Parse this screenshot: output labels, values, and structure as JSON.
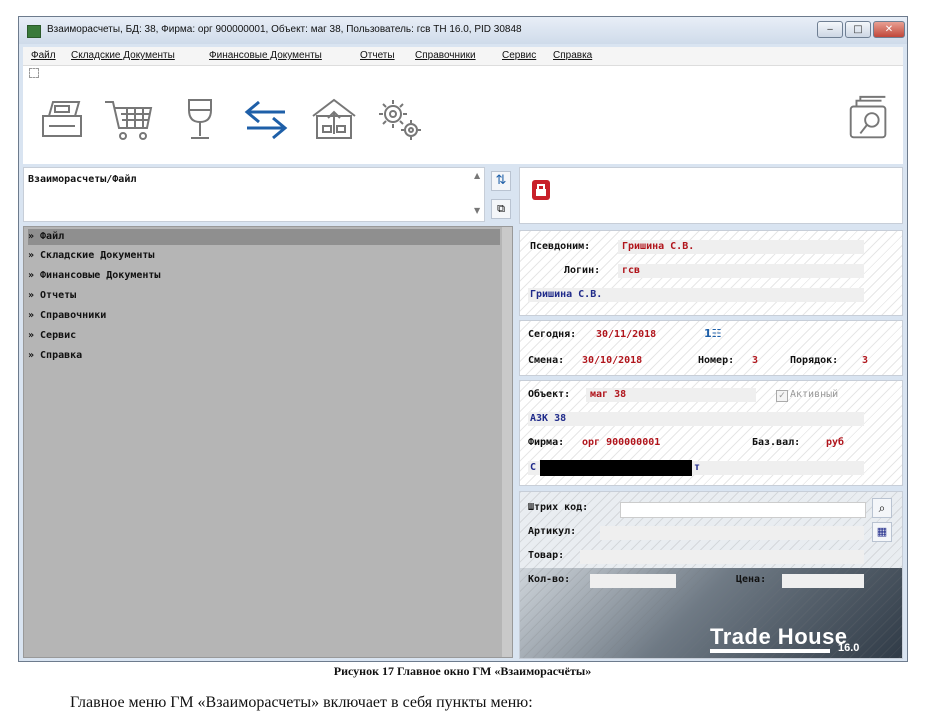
{
  "window": {
    "title": "Взаиморасчеты, БД: 38, Фирма: орг 900000001, Объект: маг 38, Пользователь: гсв  TH 16.0, PID 30848",
    "minimize_label": "‒",
    "maximize_label": "□",
    "close_label": "✕"
  },
  "menu": [
    {
      "label": "Файл"
    },
    {
      "label": "Складские Документы"
    },
    {
      "label": "Финансовые Документы"
    },
    {
      "label": "Отчеты"
    },
    {
      "label": "Справочники"
    },
    {
      "label": "Сервис"
    },
    {
      "label": "Справка"
    }
  ],
  "toolbar": {
    "icons": [
      "cash-register-icon",
      "shopping-cart-icon",
      "wine-glass-icon",
      "exchange-arrows-icon",
      "warehouse-upload-icon",
      "gears-icon"
    ],
    "right_icon": "document-search-icon"
  },
  "breadcrumb": {
    "text": "Взаиморасчеты/Файл",
    "scroll_up": "▲",
    "scroll_down": "▼"
  },
  "tree": {
    "items": [
      {
        "label": "» Файл",
        "selected": true
      },
      {
        "label": "» Складские Документы"
      },
      {
        "label": "» Финансовые Документы"
      },
      {
        "label": "» Отчеты"
      },
      {
        "label": "» Справочники"
      },
      {
        "label": "» Сервис"
      },
      {
        "label": "» Справка"
      }
    ]
  },
  "user": {
    "alias_label": "Псевдоним:",
    "alias_value": "Гришина С.В.",
    "login_label": "Логин:",
    "login_value": "гсв",
    "full_name": "Гришина С.В."
  },
  "date": {
    "today_label": "Сегодня:",
    "today_value": "30/11/2018",
    "shift_label": "Смена:",
    "shift_value": "30/10/2018",
    "number_label": "Номер:",
    "number_value": "3",
    "order_label": "Порядок:",
    "order_value": "3"
  },
  "object": {
    "object_label": "Объект:",
    "object_value": "маг 38",
    "active_label": "Активный",
    "name": "АЗК 38",
    "firm_label": "Фирма:",
    "firm_value": "орг 900000001",
    "currency_label": "Баз.вал:",
    "currency_value": "руб",
    "redacted_prefix": "С",
    "redacted_suffix": "т"
  },
  "goods": {
    "barcode_label": "Штрих код:",
    "article_label": "Артикул:",
    "product_label": "Товар:",
    "qty_label": "Кол-во:",
    "price_label": "Цена:"
  },
  "brand": {
    "name": "Trade House",
    "version": "16.0"
  },
  "document": {
    "caption": "Рисунок 17 Главное окно ГМ «Взаиморасчёты»",
    "paragraph": "Главное меню ГМ «Взаиморасчеты» включает в себя пункты меню:"
  },
  "colors": {
    "value_red": "#b0141b",
    "name_blue": "#1f2a8a",
    "toolbar_blue": "#1e5fa8"
  }
}
